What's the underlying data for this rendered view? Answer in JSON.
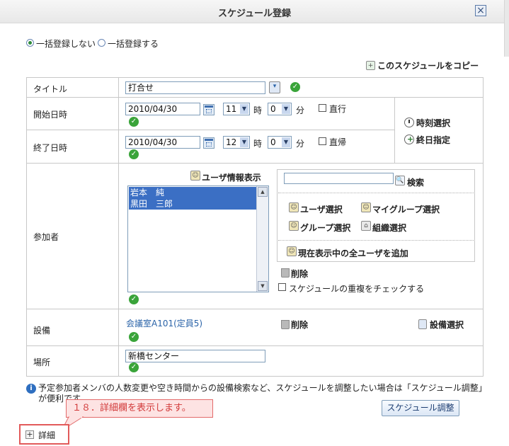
{
  "window": {
    "title": "スケジュール登録",
    "close_icon": "×"
  },
  "bulk": {
    "option_no": "一括登録しない",
    "option_yes": "一括登録する",
    "selected": "no"
  },
  "copy_link": "このスケジュールをコピー",
  "form": {
    "title_label": "タイトル",
    "title_value": "打合せ",
    "start_label": "開始日時",
    "start_date": "2010/04/30",
    "start_hour": "11",
    "start_min": "0",
    "end_label": "終了日時",
    "end_date": "2010/04/30",
    "end_hour": "12",
    "end_min": "0",
    "hour_unit": "時",
    "min_unit": "分",
    "direct_go": "直行",
    "direct_return": "直帰",
    "time_select": "時刻選択",
    "all_day": "終日指定",
    "participants_label": "参加者",
    "user_info": "ユーザ情報表示",
    "participants": [
      "岩本　純",
      "黒田　三郎"
    ],
    "search_button": "検索",
    "user_select": "ユーザ選択",
    "my_group_select": "マイグループ選択",
    "group_select": "グループ選択",
    "org_select": "組織選択",
    "add_all_users": "現在表示中の全ユーザを追加",
    "delete": "削除",
    "dup_check": "スケジュールの重複をチェックする",
    "equipment_label": "設備",
    "equipment_value": "会議室A101(定員5)",
    "equipment_delete": "削除",
    "equipment_select": "設備選択",
    "place_label": "場所",
    "place_value": "新橋センター"
  },
  "notice": "予定参加者メンバの人数変更や空き時間からの設備検索など、スケジュールを調整したい場合は「スケジュール調整」が便利です。",
  "adjust_button": "スケジュール調整",
  "callout": "１８．詳細欄を表示します。",
  "detail_toggle": "詳細",
  "colors": {
    "accent_green": "#3aa43a",
    "selection_blue": "#3b6fc4",
    "callout_red": "#e25a5a"
  }
}
